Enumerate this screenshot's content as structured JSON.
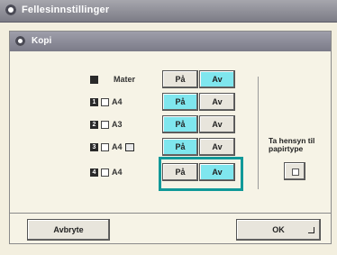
{
  "window": {
    "title": "Fellesinnstillinger"
  },
  "panel": {
    "title": "Kopi"
  },
  "rows": [
    {
      "label": "Mater",
      "on_label": "På",
      "off_label": "Av",
      "selected": "Av"
    },
    {
      "label": "A4",
      "prefix": "1",
      "on_label": "På",
      "off_label": "Av",
      "selected": "På"
    },
    {
      "label": "A3",
      "prefix": "2",
      "on_label": "På",
      "off_label": "Av",
      "selected": "På"
    },
    {
      "label": "A4",
      "prefix": "3",
      "on_label": "På",
      "off_label": "Av",
      "selected": "På"
    },
    {
      "label": "A4",
      "prefix": "4",
      "on_label": "På",
      "off_label": "Av",
      "selected": "Av"
    }
  ],
  "side": {
    "label": "Ta hensyn til papirtype"
  },
  "footer": {
    "cancel_label": "Avbryte",
    "ok_label": "OK"
  },
  "colors": {
    "selected": "#7fe6ee",
    "focus": "#119999"
  }
}
